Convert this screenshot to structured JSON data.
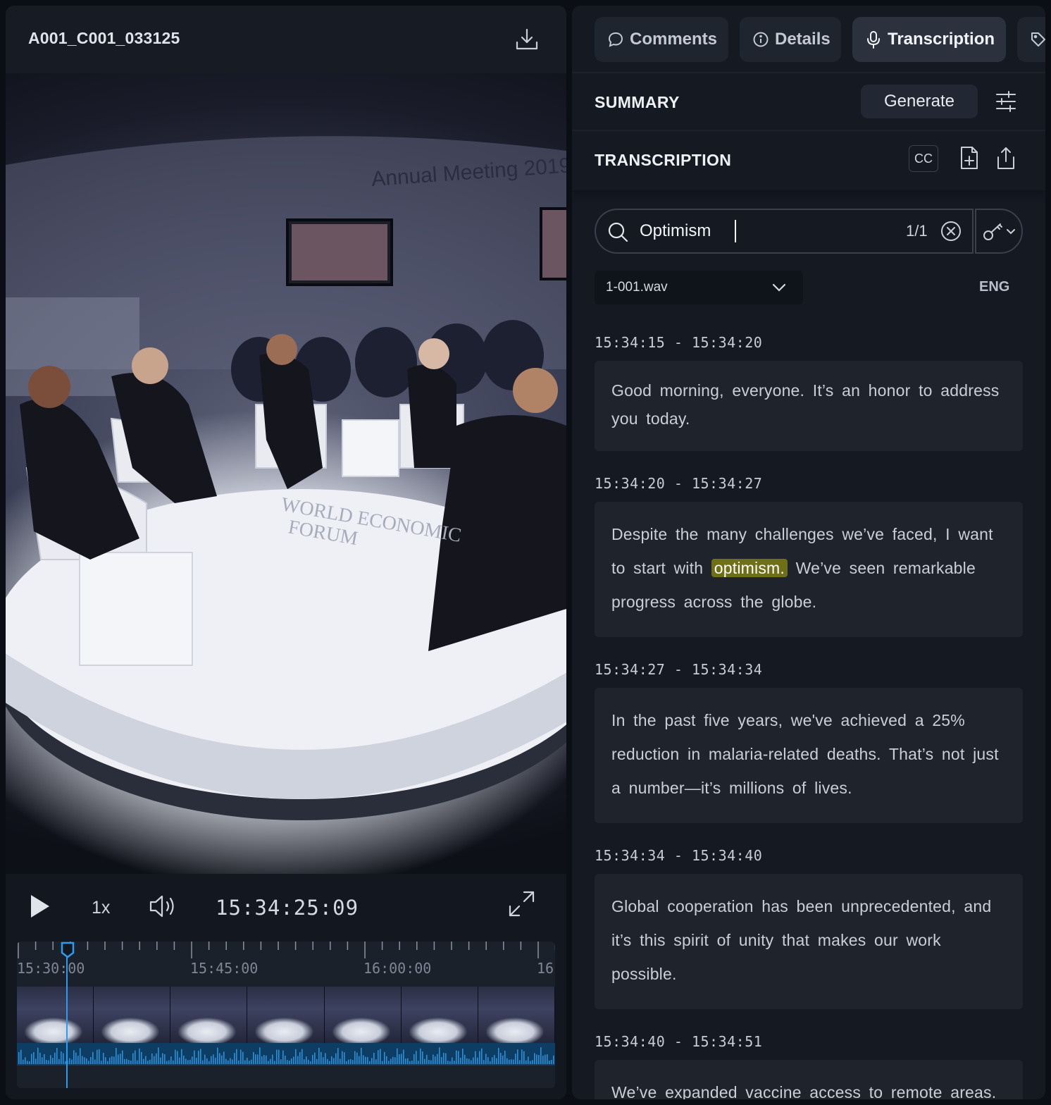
{
  "clip": {
    "title": "A001_C001_033125"
  },
  "player": {
    "speed": "1x",
    "timecode": "15:34:25:09",
    "timeline_labels": [
      "15:30:00",
      "15:45:00",
      "16:00:00",
      "16"
    ]
  },
  "tabs": [
    {
      "label": "Comments",
      "icon": "comment-icon",
      "active": false
    },
    {
      "label": "Details",
      "icon": "info-icon",
      "active": false
    },
    {
      "label": "Transcription",
      "icon": "microphone-icon",
      "active": true
    },
    {
      "label": "",
      "icon": "tag-icon",
      "active": false
    }
  ],
  "summary": {
    "title": "SUMMARY",
    "generate_label": "Generate"
  },
  "transcription": {
    "title": "TRANSCRIPTION",
    "cc_label": "CC"
  },
  "search": {
    "value": "Optimism",
    "match_count": "1/1"
  },
  "file": {
    "name": "1-001.wav",
    "language": "ENG"
  },
  "segments": [
    {
      "time": "15:34:15 - 15:34:20",
      "text": "Good morning, everyone. It’s an honor to address you today."
    },
    {
      "time": "15:34:20 - 15:34:27",
      "before": "Despite the many challenges we’ve faced, I want to start with ",
      "highlight": "optimism.",
      "after": " We’ve seen remarkable progress across the globe."
    },
    {
      "time": "15:34:27 - 15:34:34",
      "text": "In the past five years, we've achieved a 25% reduction in malaria-related deaths. That’s not just a number—it’s millions of lives."
    },
    {
      "time": "15:34:34 - 15:34:40",
      "text": "Global cooperation has been unprecedented, and it’s this spirit of unity that makes our work possible."
    },
    {
      "time": "15:34:40 - 15:34:51",
      "text": "We’ve expanded vaccine access to remote areas."
    }
  ],
  "colors": {
    "accent": "#2d9cf0",
    "highlight": "#6f6f18",
    "panel": "#141922"
  }
}
